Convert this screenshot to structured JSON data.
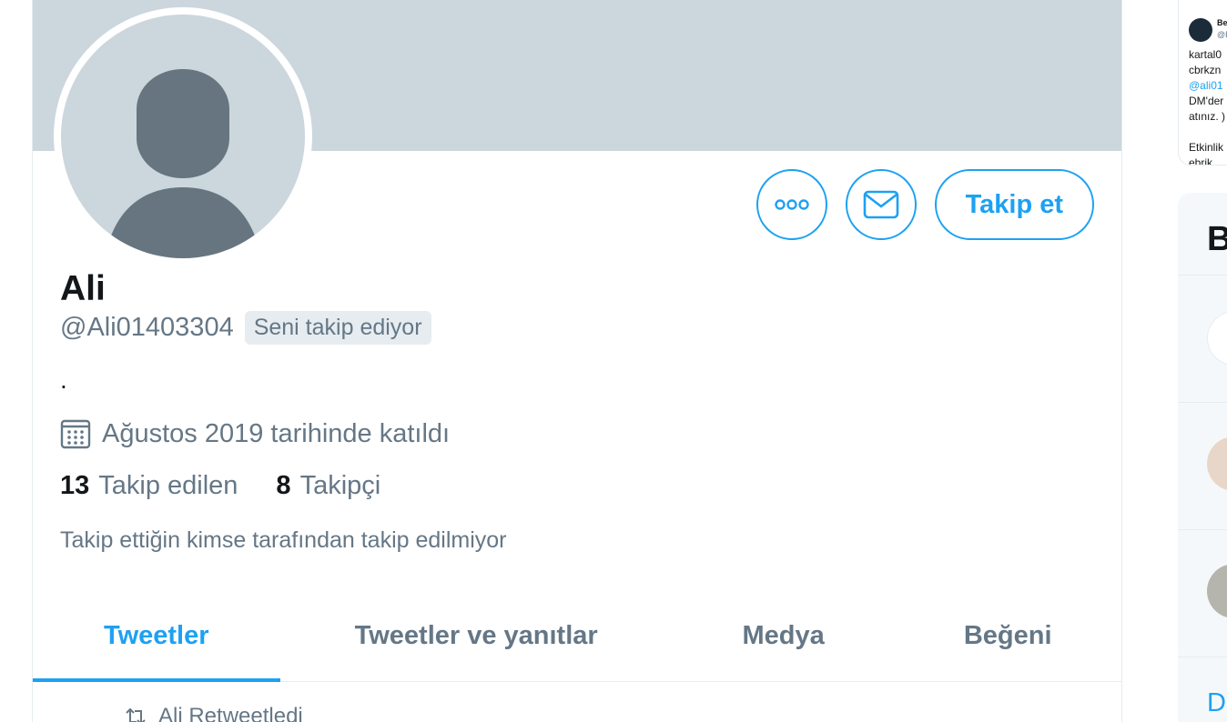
{
  "profile": {
    "name": "Ali",
    "handle": "@Ali01403304",
    "follows_you": "Seni takip ediyor",
    "bio": ".",
    "joined": "Ağustos 2019 tarihinde katıldı",
    "following_count": "13",
    "following_label": "Takip edilen",
    "followers_count": "8",
    "followers_label": "Takipçi",
    "not_followed_note": "Takip ettiğin kimse tarafından takip edilmiyor"
  },
  "actions": {
    "follow_label": "Takip et",
    "more_icon": "more-icon",
    "message_icon": "envelope-icon"
  },
  "tabs": [
    {
      "label": "Tweetler",
      "active": true
    },
    {
      "label": "Tweetler ve yanıtlar",
      "active": false
    },
    {
      "label": "Medya",
      "active": false
    },
    {
      "label": "Beğeni",
      "active": false
    }
  ],
  "timeline": {
    "retweet_label": "Ali Retweetledi"
  },
  "side": {
    "card_lines": [
      "Be",
      "@B",
      "kartal0",
      "cbrkzn",
      "@ali01",
      "DM'der",
      "atınız. )",
      "Etkinlik",
      "ebrik"
    ],
    "panel_title": "B",
    "panel_more": "Da"
  },
  "colors": {
    "accent": "#1da1f2",
    "banner": "#ccd6dd",
    "avatar_silhouette": "#66757f",
    "secondary_text": "#657786"
  }
}
